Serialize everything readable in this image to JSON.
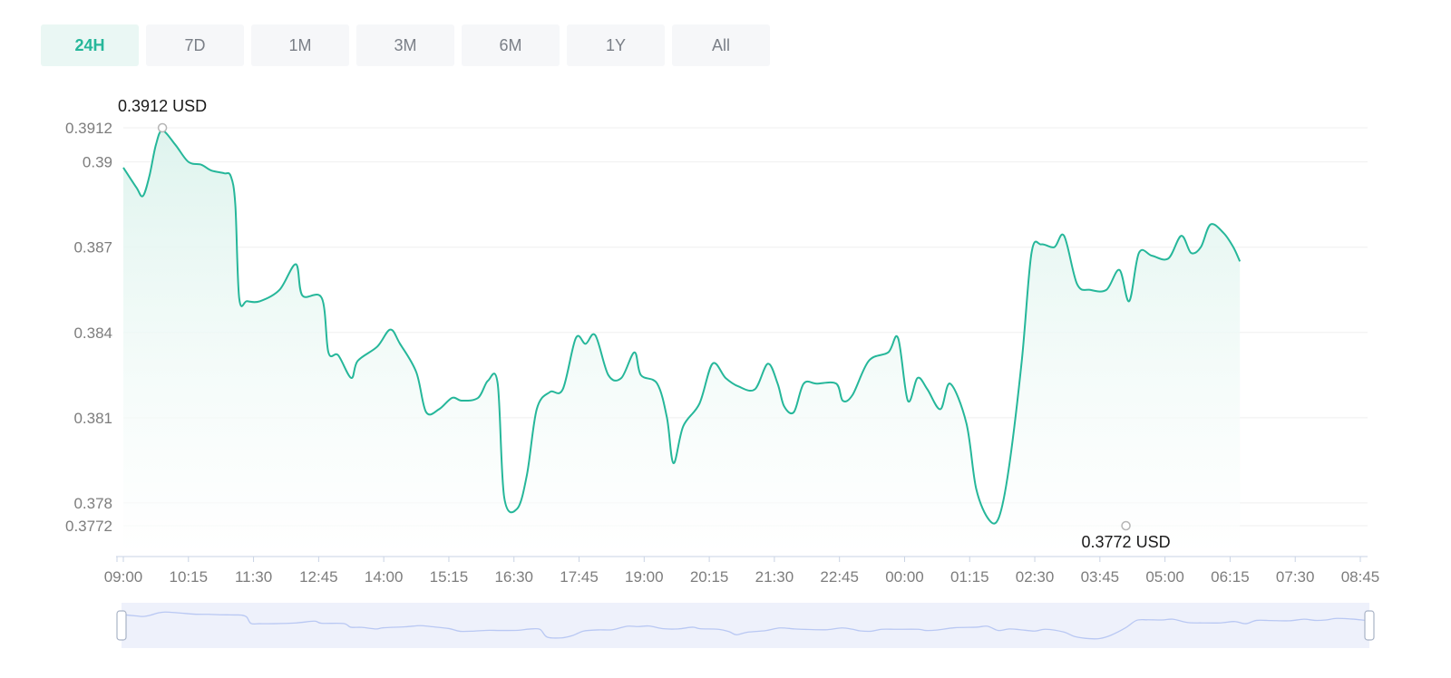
{
  "tabs": [
    {
      "label": "24H",
      "active": true
    },
    {
      "label": "7D"
    },
    {
      "label": "1M"
    },
    {
      "label": "3M"
    },
    {
      "label": "6M"
    },
    {
      "label": "1Y"
    },
    {
      "label": "All"
    }
  ],
  "colors": {
    "line": "#26b79a",
    "area_top": "#e2f5f0",
    "grid": "#efefef",
    "axis": "#c9d3e4",
    "navigator_fill": "#eef1fb",
    "navigator_line": "#b9c8f3"
  },
  "chart_data": {
    "type": "area",
    "x_ticks": [
      "09:00",
      "10:15",
      "11:30",
      "12:45",
      "14:00",
      "15:15",
      "16:30",
      "17:45",
      "19:00",
      "20:15",
      "21:30",
      "22:45",
      "00:00",
      "01:15",
      "02:30",
      "03:45",
      "05:00",
      "06:15",
      "07:30",
      "08:45"
    ],
    "y_ticks": [
      0.3912,
      0.39,
      0.387,
      0.384,
      0.381,
      0.378,
      0.3772
    ],
    "ylim": [
      0.3772,
      0.3912
    ],
    "max": {
      "x": "09:45",
      "value": 0.3912,
      "label": "0.3912 USD"
    },
    "min": {
      "x": "04:15",
      "value": 0.3772,
      "label": "0.3772 USD"
    },
    "x_unit_minutes": 75,
    "points": [
      [
        0.0,
        0.3898
      ],
      [
        0.2,
        0.3891
      ],
      [
        0.3,
        0.3888
      ],
      [
        0.4,
        0.3895
      ],
      [
        0.5,
        0.3906
      ],
      [
        0.6,
        0.3911
      ],
      [
        0.8,
        0.3906
      ],
      [
        1.0,
        0.39
      ],
      [
        1.2,
        0.3899
      ],
      [
        1.35,
        0.3897
      ],
      [
        1.55,
        0.3896
      ],
      [
        1.65,
        0.3895
      ],
      [
        1.72,
        0.3885
      ],
      [
        1.78,
        0.3852
      ],
      [
        1.9,
        0.3851
      ],
      [
        2.1,
        0.3851
      ],
      [
        2.4,
        0.3855
      ],
      [
        2.65,
        0.3864
      ],
      [
        2.75,
        0.3853
      ],
      [
        3.05,
        0.3852
      ],
      [
        3.15,
        0.3833
      ],
      [
        3.3,
        0.3832
      ],
      [
        3.5,
        0.3824
      ],
      [
        3.6,
        0.383
      ],
      [
        3.9,
        0.3835
      ],
      [
        4.1,
        0.3841
      ],
      [
        4.25,
        0.3836
      ],
      [
        4.5,
        0.3826
      ],
      [
        4.65,
        0.3812
      ],
      [
        4.85,
        0.3813
      ],
      [
        5.05,
        0.3817
      ],
      [
        5.2,
        0.3816
      ],
      [
        5.45,
        0.3817
      ],
      [
        5.6,
        0.3823
      ],
      [
        5.75,
        0.3822
      ],
      [
        5.85,
        0.3782
      ],
      [
        6.05,
        0.3778
      ],
      [
        6.2,
        0.379
      ],
      [
        6.35,
        0.3813
      ],
      [
        6.55,
        0.3819
      ],
      [
        6.75,
        0.382
      ],
      [
        6.95,
        0.3838
      ],
      [
        7.1,
        0.3836
      ],
      [
        7.25,
        0.3839
      ],
      [
        7.45,
        0.3825
      ],
      [
        7.65,
        0.3824
      ],
      [
        7.85,
        0.3833
      ],
      [
        7.95,
        0.3825
      ],
      [
        8.2,
        0.3822
      ],
      [
        8.35,
        0.381
      ],
      [
        8.45,
        0.3794
      ],
      [
        8.6,
        0.3807
      ],
      [
        8.85,
        0.3815
      ],
      [
        9.05,
        0.3829
      ],
      [
        9.25,
        0.3824
      ],
      [
        9.45,
        0.3821
      ],
      [
        9.7,
        0.382
      ],
      [
        9.9,
        0.3829
      ],
      [
        10.05,
        0.3822
      ],
      [
        10.15,
        0.3814
      ],
      [
        10.3,
        0.3812
      ],
      [
        10.45,
        0.3822
      ],
      [
        10.65,
        0.3822
      ],
      [
        10.95,
        0.3822
      ],
      [
        11.05,
        0.3816
      ],
      [
        11.2,
        0.3818
      ],
      [
        11.45,
        0.383
      ],
      [
        11.75,
        0.3833
      ],
      [
        11.9,
        0.3838
      ],
      [
        12.05,
        0.3816
      ],
      [
        12.2,
        0.3824
      ],
      [
        12.35,
        0.382
      ],
      [
        12.55,
        0.3813
      ],
      [
        12.7,
        0.3822
      ],
      [
        12.95,
        0.3808
      ],
      [
        13.1,
        0.3785
      ],
      [
        13.3,
        0.3774
      ],
      [
        13.45,
        0.3775
      ],
      [
        13.6,
        0.3792
      ],
      [
        13.8,
        0.383
      ],
      [
        13.95,
        0.3868
      ],
      [
        14.1,
        0.3871
      ],
      [
        14.3,
        0.387
      ],
      [
        14.45,
        0.3874
      ],
      [
        14.65,
        0.3857
      ],
      [
        14.85,
        0.3855
      ],
      [
        15.1,
        0.3855
      ],
      [
        15.3,
        0.3862
      ],
      [
        15.45,
        0.3851
      ],
      [
        15.6,
        0.3868
      ],
      [
        15.8,
        0.3867
      ],
      [
        16.05,
        0.3866
      ],
      [
        16.25,
        0.3874
      ],
      [
        16.4,
        0.3868
      ],
      [
        16.55,
        0.387
      ],
      [
        16.7,
        0.3878
      ],
      [
        16.9,
        0.3875
      ],
      [
        17.05,
        0.387
      ],
      [
        17.15,
        0.3865
      ]
    ]
  }
}
